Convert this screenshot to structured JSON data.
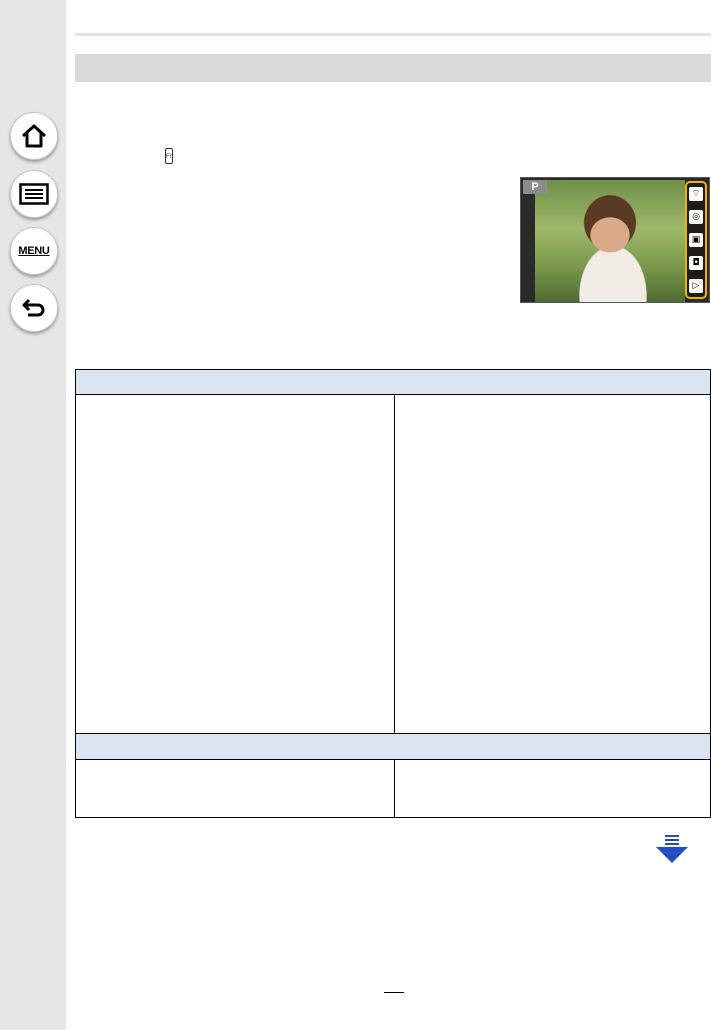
{
  "nav": {
    "menu_label": "MENU",
    "buttons": [
      "home-icon",
      "list-icon",
      "menu-icon",
      "back-icon"
    ]
  },
  "camera_screen": {
    "mode": "P",
    "tab_icons": [
      "wifi-icon",
      "dial-icon",
      "image-icon",
      "movie-icon",
      "fn-icon"
    ]
  },
  "fn_icon_label": "Fn",
  "page": {
    "number": ""
  }
}
